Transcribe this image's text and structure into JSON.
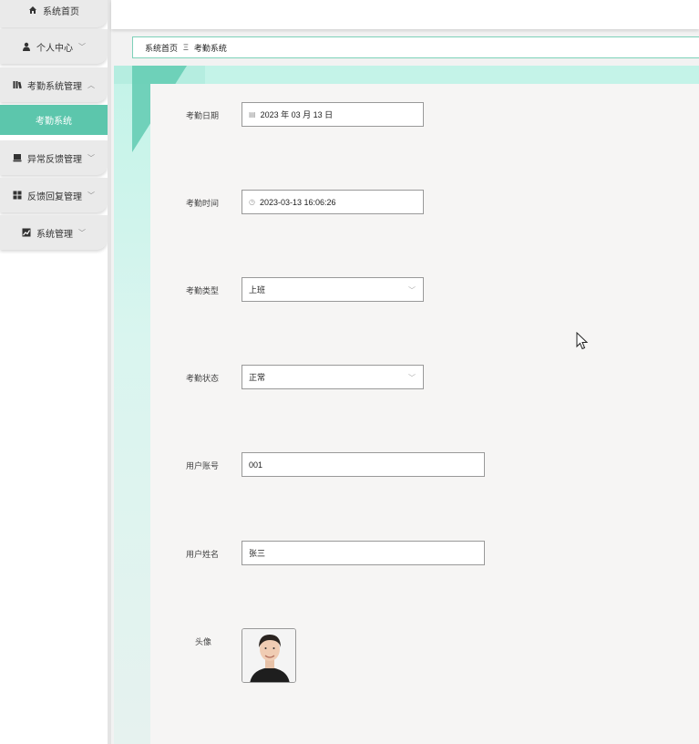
{
  "sidebar": {
    "items": [
      {
        "label": "系统首页",
        "icon": "home-icon"
      },
      {
        "label": "个人中心",
        "icon": "user-icon"
      },
      {
        "label": "考勤系统管理",
        "icon": "book-icon"
      },
      {
        "label": "考勤系统",
        "icon": ""
      },
      {
        "label": "异常反馈管理",
        "icon": "inbox-icon"
      },
      {
        "label": "反馈回复管理",
        "icon": "grid-icon"
      },
      {
        "label": "系统管理",
        "icon": "chart-icon"
      }
    ]
  },
  "breadcrumb": {
    "home": "系统首页",
    "separator": "Ξ",
    "current": "考勤系统"
  },
  "form": {
    "date": {
      "label": "考勤日期",
      "value": "2023 年 03 月 13 日"
    },
    "time": {
      "label": "考勤时间",
      "value": "2023-03-13 16:06:26"
    },
    "type": {
      "label": "考勤类型",
      "value": "上班"
    },
    "status": {
      "label": "考勤状态",
      "value": "正常"
    },
    "account": {
      "label": "用户账号",
      "value": "001"
    },
    "name": {
      "label": "用户姓名",
      "value": "张三"
    },
    "avatar": {
      "label": "头像"
    }
  },
  "colors": {
    "accent": "#5cc6ac",
    "main_bg": "#c3f3e8",
    "card": "#f6f5f4"
  }
}
